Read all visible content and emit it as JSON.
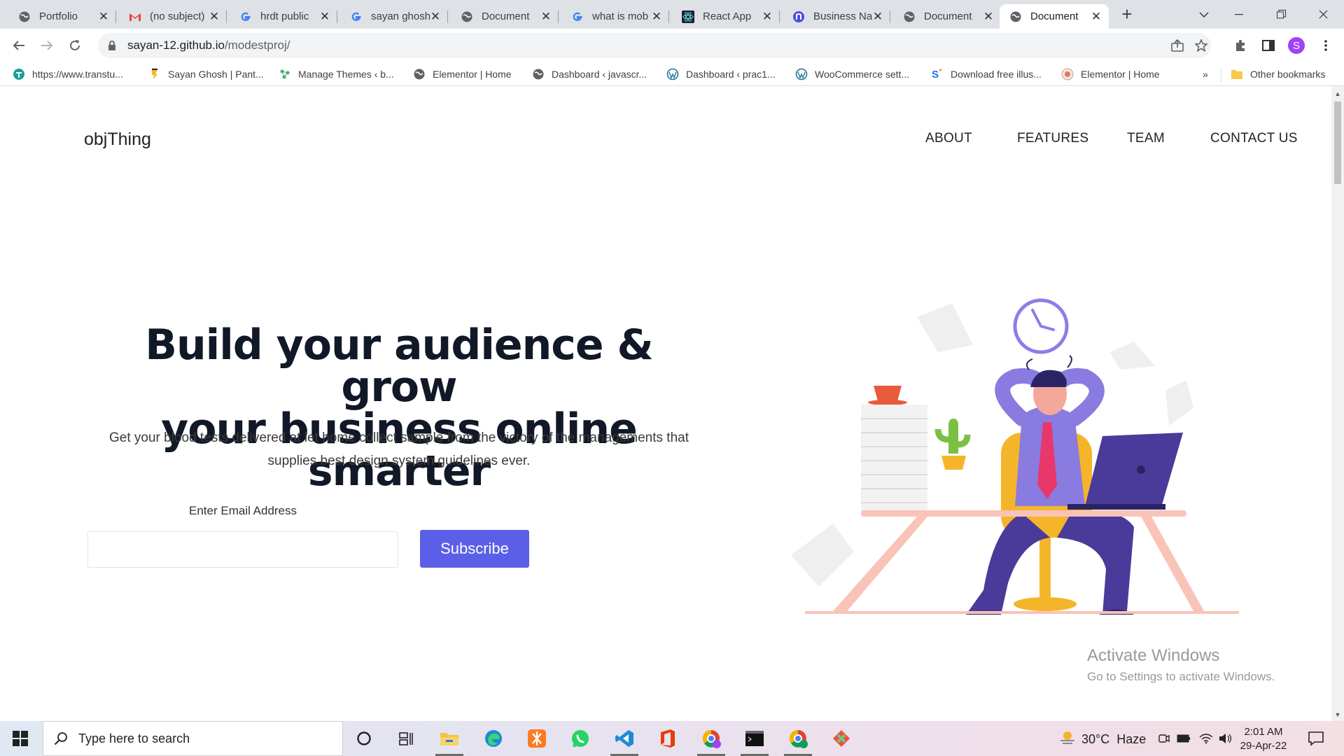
{
  "browser": {
    "tabs": [
      {
        "title": "Portfolio",
        "icon": "globe-icon"
      },
      {
        "title": "(no subject)",
        "icon": "gmail-icon"
      },
      {
        "title": "hrdt public",
        "icon": "google-icon"
      },
      {
        "title": "sayan ghosh",
        "icon": "google-icon"
      },
      {
        "title": "Document",
        "icon": "globe-icon"
      },
      {
        "title": "what is mob",
        "icon": "google-icon"
      },
      {
        "title": "React App",
        "icon": "react-icon"
      },
      {
        "title": "Business Na",
        "icon": "n-icon"
      },
      {
        "title": "Document",
        "icon": "globe-icon"
      },
      {
        "title": "Document",
        "icon": "globe-icon",
        "active": true
      }
    ],
    "new_tab_label": "+",
    "url_host": "sayan-12.github.io",
    "url_path": "/modestproj/",
    "profile_initial": "S",
    "bookmarks": [
      {
        "label": "https://www.transtu...",
        "icon": "transtutors-icon"
      },
      {
        "label": "Sayan Ghosh | Pant...",
        "icon": "bookmark-pantheon-icon"
      },
      {
        "label": "Manage Themes ‹ b...",
        "icon": "themes-icon"
      },
      {
        "label": "Elementor | Home",
        "icon": "globe-icon"
      },
      {
        "label": "Dashboard ‹ javascr...",
        "icon": "globe-icon"
      },
      {
        "label": "Dashboard ‹ prac1...",
        "icon": "wordpress-icon"
      },
      {
        "label": "WooCommerce sett...",
        "icon": "wordpress-icon"
      },
      {
        "label": "Download free illus...",
        "icon": "storyset-icon"
      },
      {
        "label": "Elementor | Home",
        "icon": "elementor-icon"
      }
    ],
    "bookmarks_overflow": "»",
    "other_bookmarks": "Other bookmarks"
  },
  "site": {
    "brand": "objThing",
    "nav": [
      "ABOUT",
      "FEATURES",
      "TEAM",
      "CONTACT US"
    ],
    "hero_title_line1": "Build your audience & grow",
    "hero_title_line2": "your business online smarter",
    "hero_sub_line1": "Get your blood tests delivered at let home collect sample from the victory of the managements that",
    "hero_sub_line2": "supplies best design system guidelines ever.",
    "email_label": "Enter Email Address",
    "email_value": "",
    "subscribe_label": "Subscribe",
    "accent": "#5b5fe8"
  },
  "watermark": {
    "line1": "Activate Windows",
    "line2": "Go to Settings to activate Windows."
  },
  "taskbar": {
    "search_placeholder": "Type here to search",
    "apps": [
      "cortana-icon",
      "task-view-icon",
      "file-explorer-icon",
      "edge-icon",
      "xampp-icon",
      "whatsapp-icon",
      "vscode-icon",
      "office-icon",
      "chrome-profile-icon",
      "terminal-icon",
      "chrome-icon",
      "git-icon"
    ],
    "weather": "30°C  Haze",
    "time": "2:01 AM",
    "date": "29-Apr-22"
  }
}
